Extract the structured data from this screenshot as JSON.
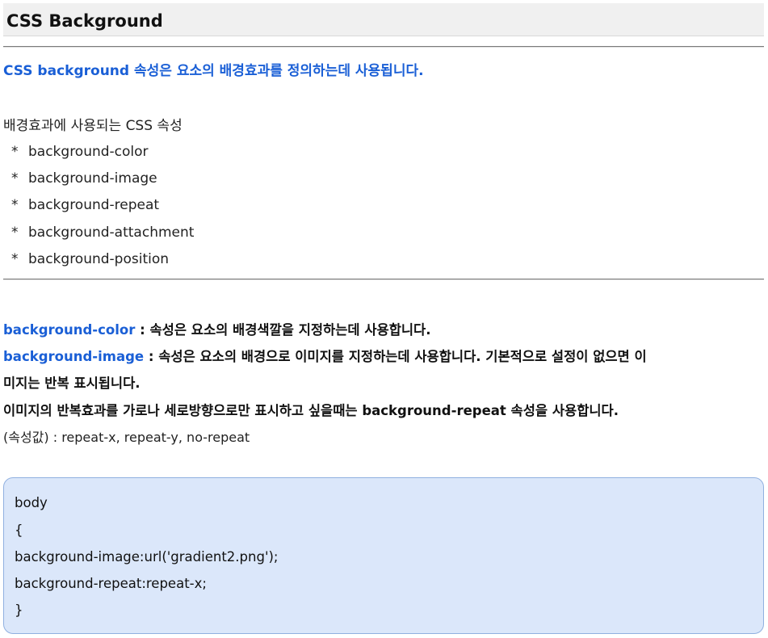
{
  "title": "CSS Background",
  "intro": "CSS background 속성은 요소의 배경효과를 정의하는데 사용됩니다.",
  "list_heading": "배경효과에 사용되는 CSS 속성",
  "bullet_symbol": "*",
  "properties_list": [
    "background-color",
    "background-image",
    "background-repeat",
    "background-attachment",
    "background-position"
  ],
  "descriptions": {
    "color_name": "background-color",
    "color_text": " : 속성은 요소의 배경색깔을 지정하는데 사용합니다.",
    "image_name": "background-image",
    "image_text": " : 속성은 요소의 배경으로 이미지를 지정하는데 사용합니다. 기본적으로 설정이 없으면 이",
    "image_text_cont": "미지는 반복 표시됩니다.",
    "repeat_text": "이미지의 반복효과를 가로나 세로방향으로만 표시하고 싶을때는 background-repeat 속성을 사용합니다.",
    "values_text": "(속성값) : repeat-x, repeat-y, no-repeat"
  },
  "code_lines": [
    "body",
    "{",
    "background-image:url('gradient2.png');",
    "background-repeat:repeat-x;",
    "}"
  ],
  "colors": {
    "accent_blue": "#1a5fd6",
    "code_background": "#dbe7fa",
    "code_border": "#90b0e0",
    "title_bar": "#f0f0f0"
  }
}
